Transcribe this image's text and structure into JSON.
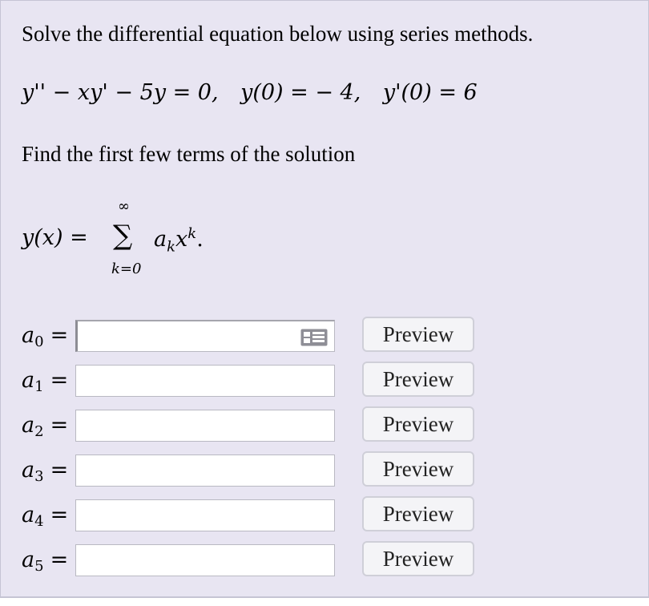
{
  "problem": {
    "intro": "Solve the differential equation below using series methods.",
    "equation": {
      "lhs": "y'' − xy' − 5y = 0,",
      "ic1": "y(0) = − 4,",
      "ic2": "y'(0) = 6"
    },
    "instruction": "Find the first few terms of the solution",
    "series": {
      "lhs": "y(x) =",
      "sum_upper": "∞",
      "sum_symbol": "∑",
      "sum_lower": "k=0",
      "term": "a",
      "term_sub": "k",
      "term_x": "x",
      "term_sup": "k",
      "period": "."
    }
  },
  "answers": [
    {
      "symbol": "a",
      "index": "0",
      "value": "",
      "button": "Preview"
    },
    {
      "symbol": "a",
      "index": "1",
      "value": "",
      "button": "Preview"
    },
    {
      "symbol": "a",
      "index": "2",
      "value": "",
      "button": "Preview"
    },
    {
      "symbol": "a",
      "index": "3",
      "value": "",
      "button": "Preview"
    },
    {
      "symbol": "a",
      "index": "4",
      "value": "",
      "button": "Preview"
    },
    {
      "symbol": "a",
      "index": "5",
      "value": "",
      "button": "Preview"
    }
  ]
}
